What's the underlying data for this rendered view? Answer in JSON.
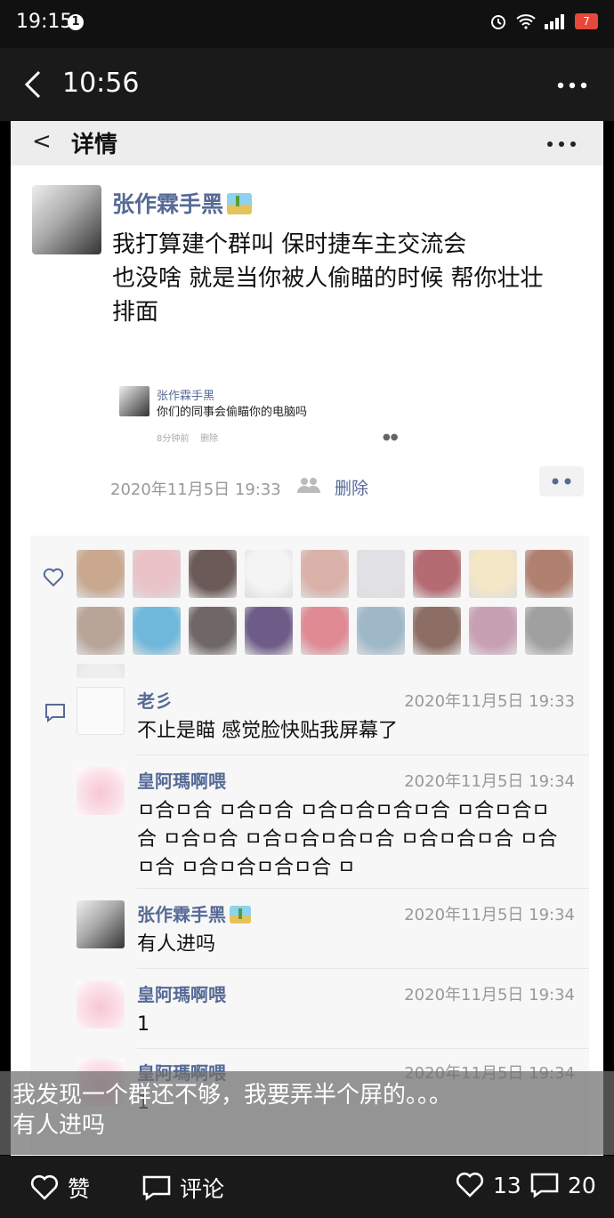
{
  "status_bar": {
    "time": "19:15",
    "notification_count": "1",
    "battery": "7"
  },
  "app_bar": {
    "title": "10:56"
  },
  "inner_bar": {
    "back": "<",
    "title": "详情"
  },
  "post": {
    "author": "张作霖手黑",
    "text_lines": [
      "我打算建个群叫 保时捷车主交流会",
      "也没啥 就是当你被人偷瞄的时候 帮你壮壮",
      "排面"
    ],
    "shared": {
      "author": "张作霖手黑",
      "text": "你们的同事会偷瞄你的电脑吗",
      "meta": "8分钟前",
      "delete": "删除"
    },
    "timestamp": "2020年11月5日 19:33",
    "delete_label": "删除"
  },
  "likes": {
    "avatar_colors": [
      "#c9a88f",
      "#e9c3c8",
      "#6b5a58",
      "#f4f4f4",
      "#d9b1a8",
      "#e2e2e6",
      "#b46b72",
      "#f3e7c8",
      "#b08070",
      "#b9a498",
      "#6fb8dc",
      "#6f6666",
      "#6e5b88",
      "#e08a94",
      "#9fb8c8",
      "#8c6e64",
      "#c8a0b4",
      "#a0a0a0",
      "#eeeeee"
    ]
  },
  "comments": [
    {
      "name": "老彡",
      "time": "2020年11月5日 19:33",
      "text": "不止是瞄 感觉脸快贴我屏幕了"
    },
    {
      "name": "皇阿瑪啊喂",
      "time": "2020年11月5日 19:34",
      "text": "ㅁ合ㅁ合 ㅁ合ㅁ合 ㅁ合ㅁ合ㅁ合ㅁ合 ㅁ合ㅁ合ㅁ合 ㅁ合ㅁ合 ㅁ合ㅁ合ㅁ合ㅁ合 ㅁ合ㅁ合ㅁ合 ㅁ合ㅁ合 ㅁ合ㅁ合ㅁ合ㅁ合 ㅁ"
    },
    {
      "name": "张作霖手黑",
      "time": "2020年11月5日 19:34",
      "text": "有人进吗"
    },
    {
      "name": "皇阿瑪啊喂",
      "time": "2020年11月5日 19:34",
      "text": "1"
    },
    {
      "name": "皇阿瑪啊喂",
      "time": "2020年11月5日 19:34",
      "text": "1"
    }
  ],
  "caption": {
    "line1": "我发现一个群还不够，我要弄半个屏的。。。",
    "line2": "有人进吗"
  },
  "bottom_bar": {
    "like_label": "赞",
    "comment_label": "评论",
    "like_count": "13",
    "comment_count": "20"
  },
  "colors": {
    "link_blue": "#566a96",
    "battery_red": "#e8483a"
  }
}
